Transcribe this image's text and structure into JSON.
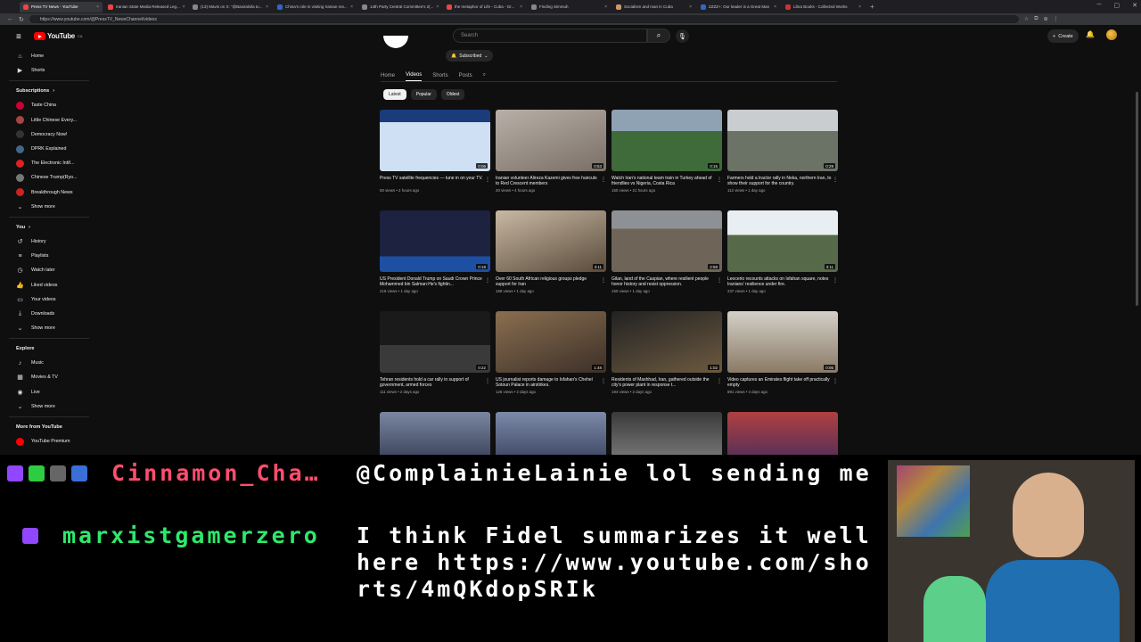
{
  "browser": {
    "tabs": [
      {
        "title": "Press TV News - YouTube",
        "color": "#e44",
        "active": true
      },
      {
        "title": "Iranian State Media Released Leg...",
        "color": "#e44"
      },
      {
        "title": "(13) Mavis on X: \"@Basiralvila to...",
        "color": "#888"
      },
      {
        "title": "China's role in visiting Iranian res...",
        "color": "#36c"
      },
      {
        "title": "14th Party Central Committee's 2(...",
        "color": "#888"
      },
      {
        "title": "the metaphor of Life - Cuba - Gr...",
        "color": "#e44"
      },
      {
        "title": "Finding Simmuh",
        "color": "#888"
      },
      {
        "title": "Socialism and man in Cuba",
        "color": "#c96"
      },
      {
        "title": "ZZZZ+: Our leader is a Great Man",
        "color": "#36c"
      },
      {
        "title": "Libra Books - Collected Works",
        "color": "#c33"
      }
    ],
    "url": "https://www.youtube.com/@PressTV_NewsChannel/videos"
  },
  "youtube": {
    "logo": "YouTube",
    "logo_sup": "CA",
    "search_placeholder": "Search",
    "create": "Create",
    "sidebar": {
      "main": [
        {
          "icon": "home-icon",
          "glyph": "⌂",
          "label": "Home"
        },
        {
          "icon": "shorts-icon",
          "glyph": "▶",
          "label": "Shorts"
        }
      ],
      "subs_header": "Subscriptions",
      "subs": [
        {
          "label": "Taste China",
          "color": "#c03"
        },
        {
          "label": "Little Chinese Every...",
          "color": "#a44"
        },
        {
          "label": "Democracy Now!",
          "color": "#333"
        },
        {
          "label": "DPRK Explained",
          "color": "#468"
        },
        {
          "label": "The Electronic Intif...",
          "color": "#d22"
        },
        {
          "label": "Chinese Trump(Ryo...",
          "color": "#777"
        },
        {
          "label": "Breakthrough News",
          "color": "#c22"
        }
      ],
      "show_more": "Show more",
      "you_header": "You",
      "you": [
        {
          "icon": "history-icon",
          "glyph": "↺",
          "label": "History"
        },
        {
          "icon": "playlists-icon",
          "glyph": "≡",
          "label": "Playlists"
        },
        {
          "icon": "watch-later-icon",
          "glyph": "◷",
          "label": "Watch later"
        },
        {
          "icon": "liked-videos-icon",
          "glyph": "👍",
          "label": "Liked videos"
        },
        {
          "icon": "your-videos-icon",
          "glyph": "▭",
          "label": "Your videos"
        },
        {
          "icon": "downloads-icon",
          "glyph": "⤓",
          "label": "Downloads"
        }
      ],
      "explore_header": "Explore",
      "explore": [
        {
          "icon": "music-icon",
          "glyph": "♪",
          "label": "Music"
        },
        {
          "icon": "movies-icon",
          "glyph": "▦",
          "label": "Movies & TV"
        },
        {
          "icon": "live-icon",
          "glyph": "◉",
          "label": "Live"
        }
      ],
      "more_header": "More from YouTube",
      "premium": "YouTube Premium"
    },
    "channel": {
      "subscribed": "Subscribed"
    },
    "tabs": [
      "Home",
      "Videos",
      "Shorts",
      "Posts"
    ],
    "active_tab": "Videos",
    "chips": [
      "Latest",
      "Popular",
      "Oldest"
    ],
    "active_chip": "Latest",
    "videos": [
      {
        "title": "Press TV satellite frequencies — tune in on your TV.",
        "meta": "50 views • 2 hours ago",
        "duration": "0:06",
        "bg": "linear-gradient(180deg,#1a3c7a 0 20%,#cfe0f4 20% 100%)"
      },
      {
        "title": "Iranian volunteer Alireza Kazemi gives free haircuts to Red Crescent members",
        "meta": "20 views • 4 hours ago",
        "duration": "0:53",
        "bg": "linear-gradient(160deg,#b8b0a8,#7a6f66)"
      },
      {
        "title": "Watch Iran's national team train in Turkey ahead of friendlies vs Nigeria, Costa Rica",
        "meta": "150 views • 21 hours ago",
        "duration": "0:15",
        "bg": "linear-gradient(180deg,#8fa2b4 0 35%,#3f6a3a 35% 100%)"
      },
      {
        "title": "Farmers hold a tractor rally in Neka, northern Iran, to show their support for the country.",
        "meta": "112 views • 1 day ago",
        "duration": "0:29",
        "bg": "linear-gradient(180deg,#c9cdd0 0 35%,#6b7266 35% 100%)"
      },
      {
        "title": "US President Donald Trump on Saudi Crown Prince Mohammed bin Salman:He's fightin...",
        "meta": "219 views • 1 day ago",
        "duration": "0:18",
        "bg": "linear-gradient(180deg,#1c2240 0 75%,#1d4fa3 75% 100%)"
      },
      {
        "title": "Over 60 South African religious groups pledge support for Iran",
        "meta": "168 views • 1 day ago",
        "duration": "3:11",
        "bg": "linear-gradient(160deg,#c8b9a4,#5a4a3a)"
      },
      {
        "title": "Gilan, land of the Caspian, where resilient people honor history and resist oppression.",
        "meta": "150 views • 1 day ago",
        "duration": "2:58",
        "bg": "linear-gradient(180deg,#8d9196 0 30%,#6e6558 30% 100%)"
      },
      {
        "title": "Leocerio recounts attacks on Isfahan square, notes Iranians' resilience under fire.",
        "meta": "237 views • 1 day ago",
        "duration": "3:11",
        "bg": "linear-gradient(180deg,#e9eef2 0 40%,#566a4a 40% 100%)"
      },
      {
        "title": "Tehran residents hold a car rally in support of government, armed forces",
        "meta": "111 views • 2 days ago",
        "duration": "0:22",
        "bg": "linear-gradient(180deg,#1a1a1a 0 55%,#3a3a3a 55% 100%)"
      },
      {
        "title": "US journalist reports damage to Isfahan's Chehel Sotoun Palace in airstrikes.",
        "meta": "126 views • 2 days ago",
        "duration": "1:48",
        "bg": "linear-gradient(160deg,#8a6e50,#3c3028)"
      },
      {
        "title": "Residents of Mashhad, Iran, gathered outside the city's power plant in response t...",
        "meta": "194 views • 2 days ago",
        "duration": "1:02",
        "bg": "linear-gradient(160deg,#222,#6c5a40)"
      },
      {
        "title": "Video captures an Emirates flight take off practically empty",
        "meta": "891 views • 4 days ago",
        "duration": "0:06",
        "bg": "linear-gradient(180deg,#d4d0c8,#8a7a66)"
      },
      {
        "title": "",
        "meta": "",
        "duration": "",
        "bg": "linear-gradient(180deg,#7a86a0,#2a3048)"
      },
      {
        "title": "",
        "meta": "",
        "duration": "",
        "bg": "linear-gradient(180deg,#7c8aa8,#2c3450)"
      },
      {
        "title": "",
        "meta": "",
        "duration": "",
        "bg": "linear-gradient(180deg,#3a3a3a,#8a8a8a)"
      },
      {
        "title": "",
        "meta": "",
        "duration": "",
        "bg": "linear-gradient(180deg,#b04040,#3a2a60)"
      }
    ]
  },
  "chat": [
    {
      "user": "Cinnamon_Cha…",
      "user_color": "#ff4d6d",
      "message": "@ComplainieLainie lol sending me",
      "badges": [
        "#9146ff",
        "#2ecc40",
        "#666",
        "#3a6fd8"
      ]
    },
    {
      "user": "marxistgamerzero",
      "user_color": "#2ee86b",
      "message": "I think Fidel summarizes it well here https://www.youtube.com/shorts/4mQKdopSRIk",
      "badges": [
        "#9146ff"
      ]
    }
  ]
}
